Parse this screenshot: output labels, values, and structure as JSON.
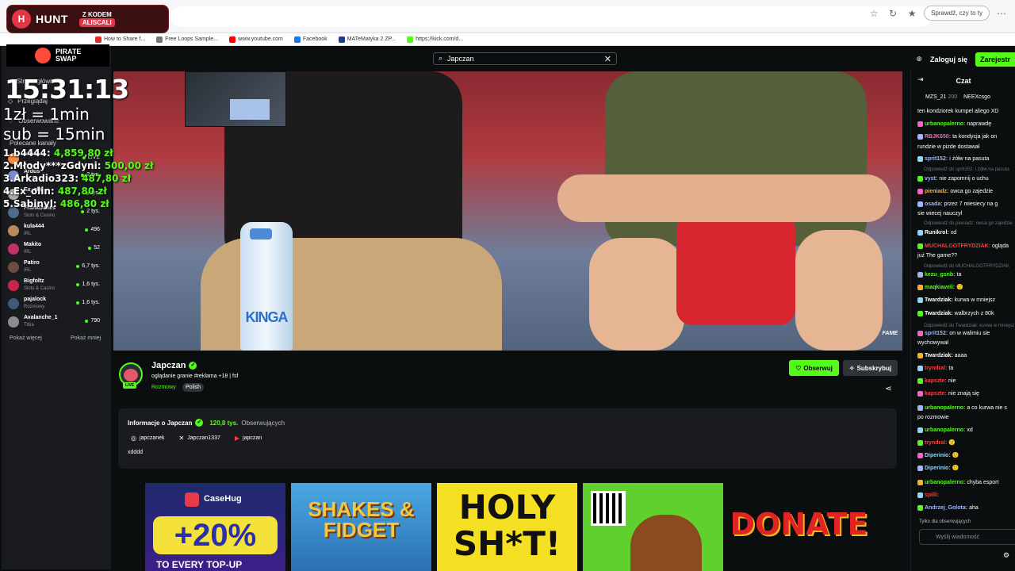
{
  "browser": {
    "search_box": "Sprawdź, czy to ty",
    "bookmarks": [
      {
        "label": "How to Share f...",
        "color": "#dd2c2c"
      },
      {
        "label": "Free Loops Sample...",
        "color": "#777777"
      },
      {
        "label": "www.youtube.com",
        "color": "#ff0000"
      },
      {
        "label": "Facebook",
        "color": "#1877f2"
      },
      {
        "label": "MATeMatyka 2 ZP...",
        "color": "#1e3a8a"
      },
      {
        "label": "https://kick.com/d...",
        "color": "#53fc18"
      }
    ]
  },
  "hunt": {
    "logo": "H",
    "name": "HUNT",
    "promo_top": "Z KODEM",
    "promo_code": "ALISCALI"
  },
  "pirate": {
    "name_line1": "PIRATE",
    "name_line2": "SWAP"
  },
  "overlay": {
    "clock": "15:31:13",
    "rate1": "1zł = 1min",
    "rate2": "sub = 15min",
    "donations": [
      {
        "rank": "1.b4444:",
        "amount": "4,859,80 zł"
      },
      {
        "rank": "2.Młody***zGdyni:",
        "amount": "500,00 zł"
      },
      {
        "rank": "3.Arkadio323:",
        "amount": "487,80 zł"
      },
      {
        "rank": "4.Ex_olin:",
        "amount": "487,80 zł"
      },
      {
        "rank": "5.Sabinyl:",
        "amount": "486,80 zł"
      }
    ]
  },
  "topbar": {
    "search_value": "Japczan",
    "login": "Zaloguj się",
    "register": "Zarejestr"
  },
  "sidebar": {
    "home": "Strona główna",
    "browse": "Przeglądaj",
    "followed": "Obserwowane",
    "recommended": "Polecane kanały",
    "channels": [
      {
        "name": "b4444",
        "cat": "",
        "viewers": "LIVE",
        "color": "#ff8a3d"
      },
      {
        "name": "Ąrdus",
        "cat": "",
        "viewers": "2 tys.",
        "color": "#7b8bd1"
      },
      {
        "name": "Ex_olin",
        "cat": "",
        "viewers": "tys.",
        "color": "#aaaaaa"
      },
      {
        "name": "FrankDimes",
        "cat": "Slots & Casino",
        "viewers": "2 tys.",
        "color": "#4f6b8c"
      },
      {
        "name": "kula444",
        "cat": "IRL",
        "viewers": "496",
        "color": "#b98a5a"
      },
      {
        "name": "Makito",
        "cat": "IRL",
        "viewers": "52",
        "color": "#c0306b"
      },
      {
        "name": "Patiro",
        "cat": "IRL",
        "viewers": "6,7 tys.",
        "color": "#6d4c41"
      },
      {
        "name": "Bigfoltz",
        "cat": "Slots & Casino",
        "viewers": "1,6 tys.",
        "color": "#c9264a"
      },
      {
        "name": "pajalock",
        "cat": "Rozmowy",
        "viewers": "1,6 tys.",
        "color": "#3f5a7a"
      },
      {
        "name": "Avalanche_1",
        "cat": "Tibia",
        "viewers": "790",
        "color": "#8d8d8d"
      }
    ],
    "show_more": "Pokaż więcej",
    "show_less": "Pokaż mniej"
  },
  "video": {
    "bottle_label": "KINGA",
    "watermark": "FAME"
  },
  "channel": {
    "name": "Japczan",
    "title": "oglądanie granie  #reklama +18 | fsf",
    "category": "Rozmowy",
    "language": "Polish",
    "live": "LIVE",
    "follow": "Obserwuj",
    "subscribe": "Subskrybuj"
  },
  "about": {
    "title": "Informacje o Japczan",
    "followers": "120,8 tys.",
    "followers_label": "Obserwujących",
    "socials": [
      {
        "icon": "◎",
        "name": "instagram-icon",
        "handle": "japczanek"
      },
      {
        "icon": "✕",
        "name": "x-icon",
        "handle": "Japczan1337"
      },
      {
        "icon": "▶",
        "name": "youtube-icon",
        "handle": "japczan"
      }
    ],
    "bio": "xdddd"
  },
  "panels": {
    "casehug_brand": "CaseHug",
    "casehug_pct": "+20%",
    "casehug_sub": "TO EVERY TOP-UP",
    "shakes": "SHAKES & FIDGET",
    "holy": "HOLY SH*T!",
    "donate": "DONATE"
  },
  "chat": {
    "title": "Czat",
    "pinned": [
      {
        "user": "MZS_21",
        "count": "200"
      },
      {
        "user": "NEEXcsgo",
        "count": ""
      }
    ],
    "messages": [
      {
        "user": "",
        "color": "#ffffff",
        "text": "ten kondziorek kumpel aliego XD"
      },
      {
        "user": "urbanopalerno:",
        "color": "#53fc18",
        "text": "naprawdę"
      },
      {
        "user": "RBJK650:",
        "color": "#ff5fc8",
        "text": "ta kondycja jak on"
      },
      {
        "user": "",
        "color": "#ffffff",
        "text": "rundzie w pizde dostawał"
      },
      {
        "user": "sprit152:",
        "color": "#9fb6ff",
        "text": "i żółw na pasuta"
      },
      {
        "user": "vyst:",
        "color": "#9fb6ff",
        "text": "nie zapomnij o uchu"
      },
      {
        "user": "pieniadz:",
        "color": "#ffb020",
        "text": "owca go zajedzie"
      },
      {
        "user": "osada:",
        "color": "#9fb6ff",
        "text": "przez 7 miesiecy na g"
      },
      {
        "user": "",
        "color": "#ffffff",
        "text": "sie wiecej nauczył"
      },
      {
        "user": "Runikrol:",
        "color": "#ffffff",
        "text": "xd"
      },
      {
        "user": "MUCHALGOTFRYDZIAK:",
        "color": "#ff3b3b",
        "text": "ogląda"
      },
      {
        "user": "",
        "color": "#ffffff",
        "text": "już The game??"
      },
      {
        "user": "kezu_gsnb:",
        "color": "#53fc18",
        "text": "ta"
      },
      {
        "user": "maqkiaveli:",
        "color": "#53fc18",
        "text": "🙂"
      },
      {
        "user": "Twardziak:",
        "color": "#ffffff",
        "text": "kurwa w mniejsz"
      },
      {
        "user": "Twardziak:",
        "color": "#ffffff",
        "text": "walbrzych z 80k"
      },
      {
        "user": "sprit152:",
        "color": "#9fb6ff",
        "text": "on w walimiu sie"
      },
      {
        "user": "",
        "color": "#ffffff",
        "text": "wychowywał"
      },
      {
        "user": "Twardziak:",
        "color": "#ffffff",
        "text": "aaaa"
      },
      {
        "user": "tryndral:",
        "color": "#ff3b3b",
        "text": "ta"
      },
      {
        "user": "kapszte:",
        "color": "#ff3b3b",
        "text": "nie"
      },
      {
        "user": "kapszte:",
        "color": "#ff3b3b",
        "text": "nie znają się"
      },
      {
        "user": "urbanopalerno:",
        "color": "#53fc18",
        "text": "a co kurwa nie s"
      },
      {
        "user": "",
        "color": "#ffffff",
        "text": "po rozmowie"
      },
      {
        "user": "urbanopalerno:",
        "color": "#53fc18",
        "text": "xd"
      },
      {
        "user": "tryndral:",
        "color": "#ff3b3b",
        "text": "🙂"
      },
      {
        "user": "Diperinio:",
        "color": "#8fd7ff",
        "text": "🙂"
      },
      {
        "user": "Diperinio:",
        "color": "#8fd7ff",
        "text": "🙂"
      },
      {
        "user": "urbanopalerno:",
        "color": "#53fc18",
        "text": "chyba esport"
      },
      {
        "user": "spilli:",
        "color": "#ff3b3b",
        "text": ""
      },
      {
        "user": "Andrzej_Golota:",
        "color": "#9fb6ff",
        "text": "aha"
      }
    ],
    "replies": [
      "Odpowiedź do sprit152: i żółw na pasuta",
      "Odpowiedź do pieniadz: owca go zajedzie",
      "Odpowiedź do MUCHALGOTFRYDZIAK",
      "Odpowiedź do Twardziak: kurwa w mniejsz"
    ],
    "followers_only": "Tylko dla obserwujących",
    "placeholder": "Wyślij wiadomość"
  }
}
